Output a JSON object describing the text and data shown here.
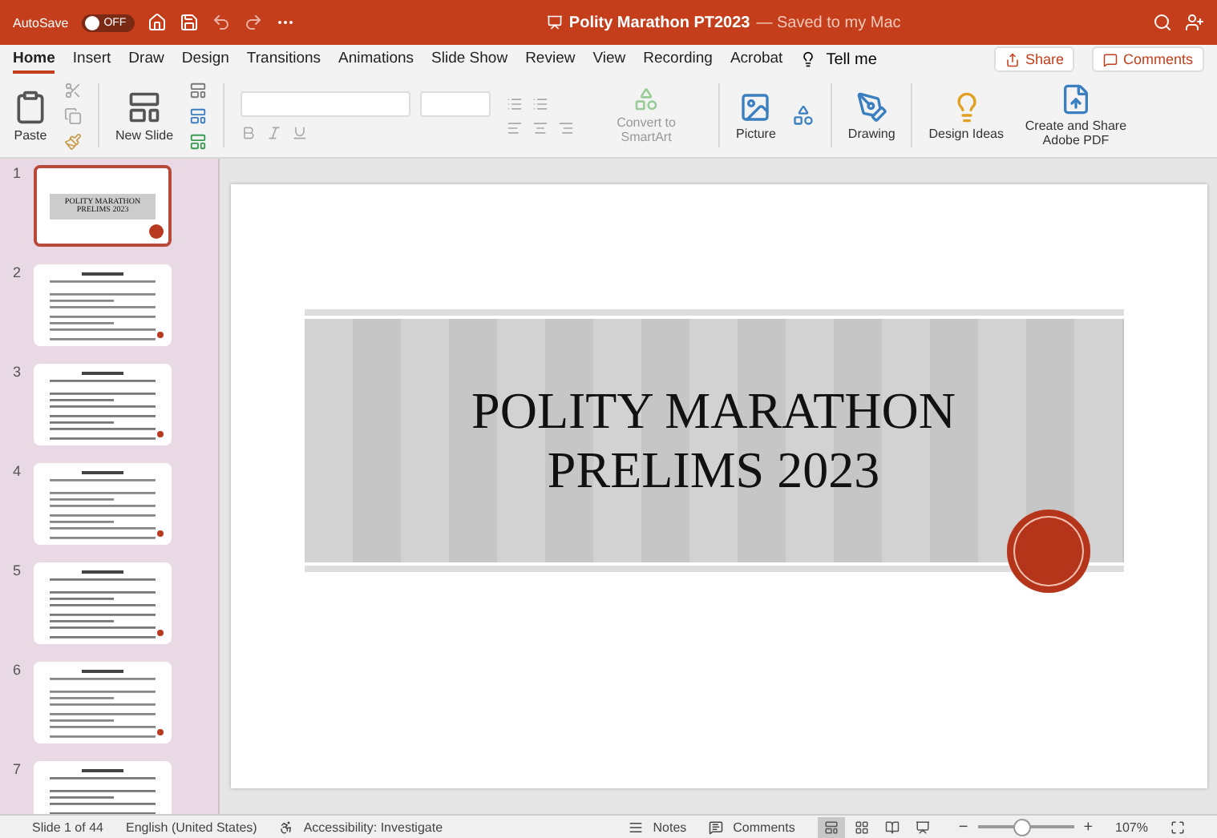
{
  "title_bar": {
    "autosave_label": "AutoSave",
    "autosave_state": "OFF",
    "autosave_on": false,
    "document_title": "Polity Marathon PT2023",
    "saved_status": "— Saved to my Mac"
  },
  "tabs": [
    {
      "label": "Home",
      "selected": true
    },
    {
      "label": "Insert",
      "selected": false
    },
    {
      "label": "Draw",
      "selected": false
    },
    {
      "label": "Design",
      "selected": false
    },
    {
      "label": "Transitions",
      "selected": false
    },
    {
      "label": "Animations",
      "selected": false
    },
    {
      "label": "Slide Show",
      "selected": false
    },
    {
      "label": "Review",
      "selected": false
    },
    {
      "label": "View",
      "selected": false
    },
    {
      "label": "Recording",
      "selected": false
    },
    {
      "label": "Acrobat",
      "selected": false
    }
  ],
  "tell_me": "Tell me",
  "share_button": "Share",
  "comments_button": "Comments",
  "ribbon": {
    "paste": "Paste",
    "new_slide": "New Slide",
    "convert_smartart": "Convert to SmartArt",
    "picture": "Picture",
    "drawing": "Drawing",
    "design_ideas": "Design Ideas",
    "adobe_pdf": "Create and Share Adobe PDF"
  },
  "slides": [
    {
      "number": "1",
      "selected": true,
      "kind": "title",
      "title": "POLITY MARATHON PRELIMS 2023"
    },
    {
      "number": "2",
      "selected": false,
      "kind": "text"
    },
    {
      "number": "3",
      "selected": false,
      "kind": "text"
    },
    {
      "number": "4",
      "selected": false,
      "kind": "text"
    },
    {
      "number": "5",
      "selected": false,
      "kind": "text"
    },
    {
      "number": "6",
      "selected": false,
      "kind": "text"
    },
    {
      "number": "7",
      "selected": false,
      "kind": "text"
    }
  ],
  "slide": {
    "title_line_1": "POLITY MARATHON",
    "title_line_2": "PRELIMS 2023"
  },
  "status_bar": {
    "slide_count": "Slide 1 of 44",
    "language": "English (United States)",
    "accessibility": "Accessibility: Investigate",
    "notes": "Notes",
    "comments": "Comments",
    "zoom_out": "−",
    "zoom_slider": {
      "level": 0.45
    },
    "zoom_in": "+",
    "zoom": "107%"
  }
}
